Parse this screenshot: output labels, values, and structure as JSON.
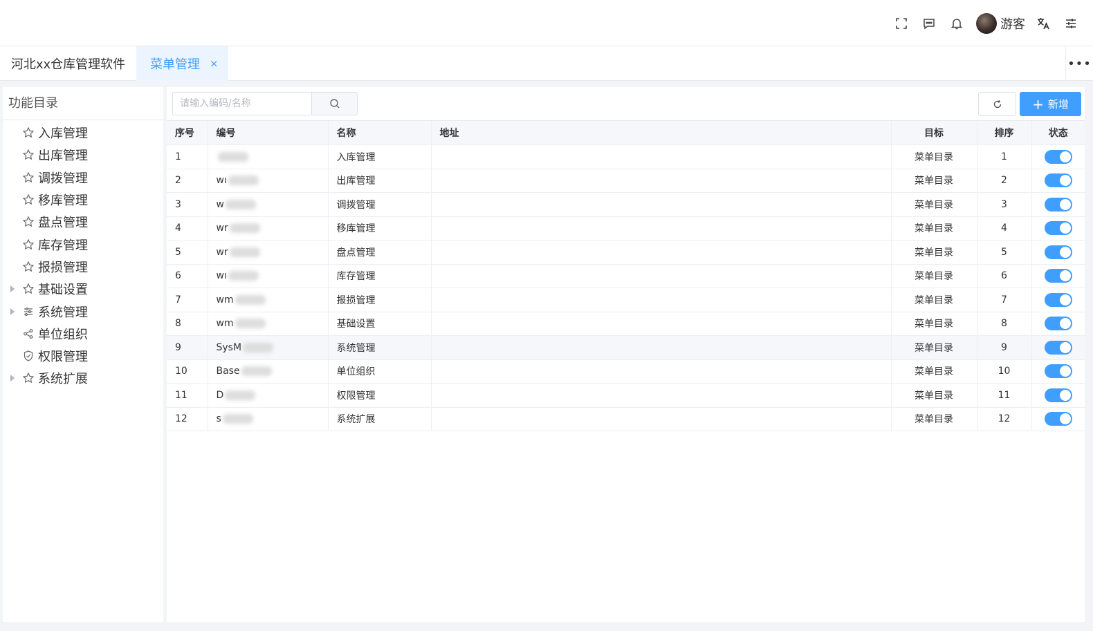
{
  "header": {
    "user_name": "游客",
    "icons": [
      "fullscreen-icon",
      "message-icon",
      "bell-icon",
      "translate-icon",
      "settings-icon"
    ]
  },
  "tabs": {
    "home": "河北xx仓库管理软件",
    "active": "菜单管理",
    "close": "×",
    "more": "•••"
  },
  "sidebar": {
    "title": "功能目录",
    "items": [
      {
        "label": "入库管理",
        "icon": "star-icon",
        "expandable": false
      },
      {
        "label": "出库管理",
        "icon": "star-icon",
        "expandable": false
      },
      {
        "label": "调拨管理",
        "icon": "star-icon",
        "expandable": false
      },
      {
        "label": "移库管理",
        "icon": "star-icon",
        "expandable": false
      },
      {
        "label": "盘点管理",
        "icon": "star-icon",
        "expandable": false
      },
      {
        "label": "库存管理",
        "icon": "star-icon",
        "expandable": false
      },
      {
        "label": "报损管理",
        "icon": "star-icon",
        "expandable": false
      },
      {
        "label": "基础设置",
        "icon": "star-icon",
        "expandable": true
      },
      {
        "label": "系统管理",
        "icon": "sliders-icon",
        "expandable": true
      },
      {
        "label": "单位组织",
        "icon": "share-icon",
        "expandable": false
      },
      {
        "label": "权限管理",
        "icon": "shield-icon",
        "expandable": false
      },
      {
        "label": "系统扩展",
        "icon": "star-icon",
        "expandable": true
      }
    ]
  },
  "toolbar": {
    "search_placeholder": "请输入编码/名称",
    "add_label": "新增",
    "add_plus": "+"
  },
  "table": {
    "columns": [
      "序号",
      "编号",
      "名称",
      "地址",
      "目标",
      "排序",
      "状态"
    ],
    "rows": [
      {
        "index": "1",
        "code": "",
        "name": "入库管理",
        "address": "",
        "target": "菜单目录",
        "sort": "1",
        "status": true
      },
      {
        "index": "2",
        "code": "wı",
        "name": "出库管理",
        "address": "",
        "target": "菜单目录",
        "sort": "2",
        "status": true
      },
      {
        "index": "3",
        "code": "w",
        "name": "调拨管理",
        "address": "",
        "target": "菜单目录",
        "sort": "3",
        "status": true
      },
      {
        "index": "4",
        "code": "wr",
        "name": "移库管理",
        "address": "",
        "target": "菜单目录",
        "sort": "4",
        "status": true
      },
      {
        "index": "5",
        "code": "wr",
        "name": "盘点管理",
        "address": "",
        "target": "菜单目录",
        "sort": "5",
        "status": true
      },
      {
        "index": "6",
        "code": "wı",
        "name": "库存管理",
        "address": "",
        "target": "菜单目录",
        "sort": "6",
        "status": true
      },
      {
        "index": "7",
        "code": "wm",
        "name": "报损管理",
        "address": "",
        "target": "菜单目录",
        "sort": "7",
        "status": true
      },
      {
        "index": "8",
        "code": "wm",
        "name": "基础设置",
        "address": "",
        "target": "菜单目录",
        "sort": "8",
        "status": true
      },
      {
        "index": "9",
        "code": "SysM",
        "name": "系统管理",
        "address": "",
        "target": "菜单目录",
        "sort": "9",
        "status": true
      },
      {
        "index": "10",
        "code": "Base",
        "name": "单位组织",
        "address": "",
        "target": "菜单目录",
        "sort": "10",
        "status": true
      },
      {
        "index": "11",
        "code": "D",
        "name": "权限管理",
        "address": "",
        "target": "菜单目录",
        "sort": "11",
        "status": true
      },
      {
        "index": "12",
        "code": "s",
        "name": "系统扩展",
        "address": "",
        "target": "菜单目录",
        "sort": "12",
        "status": true
      }
    ]
  },
  "colors": {
    "accent": "#409eff",
    "header_bg": "#f5f7fa",
    "page_bg": "#f3f4f7"
  }
}
